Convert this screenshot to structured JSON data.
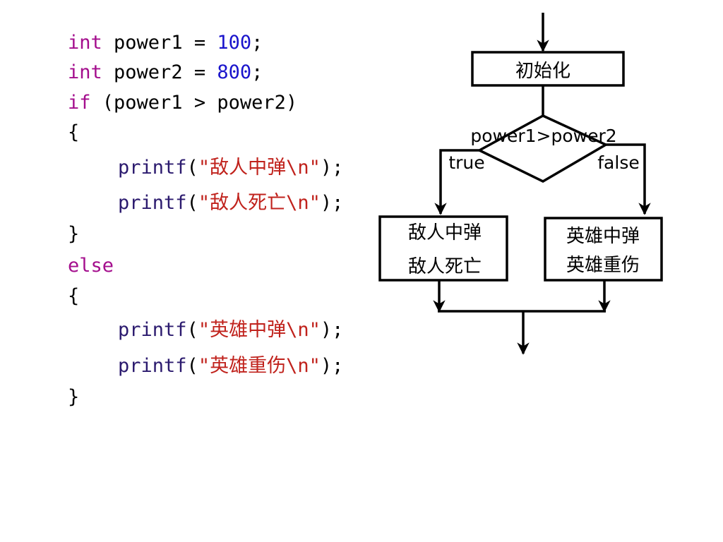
{
  "colors": {
    "keyword": "#a40e8d",
    "number": "#1a14cc",
    "function": "#2b1a6e",
    "string": "#c0221c",
    "text": "#000000",
    "line": "#000000"
  },
  "code": {
    "l1": {
      "kw": "int",
      "rest": " power1 = ",
      "num": "100",
      "end": ";"
    },
    "l2": {
      "kw": "int",
      "rest": " power2 = ",
      "num": "800",
      "end": ";"
    },
    "l3": {
      "kw": "if",
      "rest": " (power1 > power2)"
    },
    "l4": "{",
    "l5": {
      "fn": "printf",
      "open": "(",
      "str": "\"敌人中弹\\n\"",
      "close": ");"
    },
    "l6": {
      "fn": "printf",
      "open": "(",
      "str": "\"敌人死亡\\n\"",
      "close": ");"
    },
    "l7": "}",
    "l8": {
      "kw": "else"
    },
    "l9": "{",
    "l10": {
      "fn": "printf",
      "open": "(",
      "str": "\"英雄中弹\\n\"",
      "close": ");"
    },
    "l11": {
      "fn": "printf",
      "open": "(",
      "str": "\"英雄重伤\\n\"",
      "close": ");"
    },
    "l12": "}"
  },
  "flowchart": {
    "init_label": "初始化",
    "condition_label": "power1>power2",
    "true_label": "true",
    "false_label": "false",
    "true_box": {
      "line1": "敌人中弹",
      "line2": "敌人死亡"
    },
    "false_box": {
      "line1": "英雄中弹",
      "line2": "英雄重伤"
    }
  }
}
